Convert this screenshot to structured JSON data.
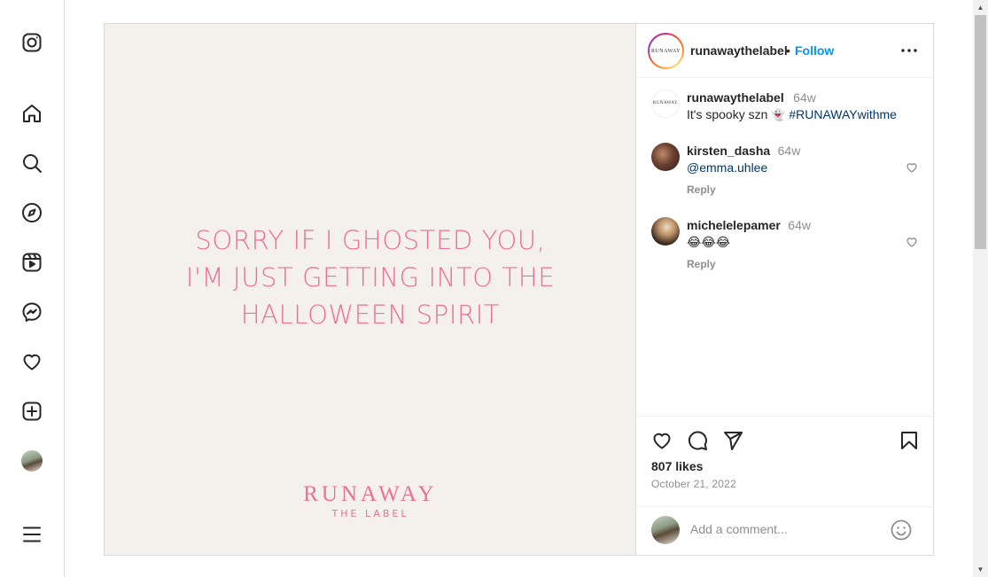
{
  "nav": {
    "items": [
      "instagram-logo",
      "home",
      "search",
      "explore",
      "reels",
      "messages",
      "notifications",
      "create",
      "profile",
      "more"
    ]
  },
  "post": {
    "image_text": {
      "line1": "SORRY IF I GHOSTED YOU,",
      "line2": "I'M JUST GETTING INTO THE",
      "line3": "HALLOWEEN SPIRIT"
    },
    "brand": {
      "name": "RUNAWAY",
      "sub": "THE LABEL"
    },
    "header": {
      "username": "runawaythelabel",
      "separator": "•",
      "follow": "Follow",
      "avatar_text": "RUNAWAY"
    },
    "caption": {
      "username": "runawaythelabel",
      "time": "64w",
      "text": "It's spooky szn",
      "emoji": "👻",
      "hashtag": "#RUNAWAYwithme"
    },
    "comments": [
      {
        "username": "kirsten_dasha",
        "time": "64w",
        "text": "@emma.uhlee",
        "reply": "Reply"
      },
      {
        "username": "michelelepamer",
        "time": "64w",
        "text": "😂😂😂",
        "reply": "Reply"
      }
    ],
    "likes": "807 likes",
    "date": "October 21, 2022",
    "add_comment_placeholder": "Add a comment..."
  },
  "colors": {
    "accent_pink": "#ec6f97",
    "follow_blue": "#0095f6",
    "image_bg": "#f4f1ed"
  }
}
